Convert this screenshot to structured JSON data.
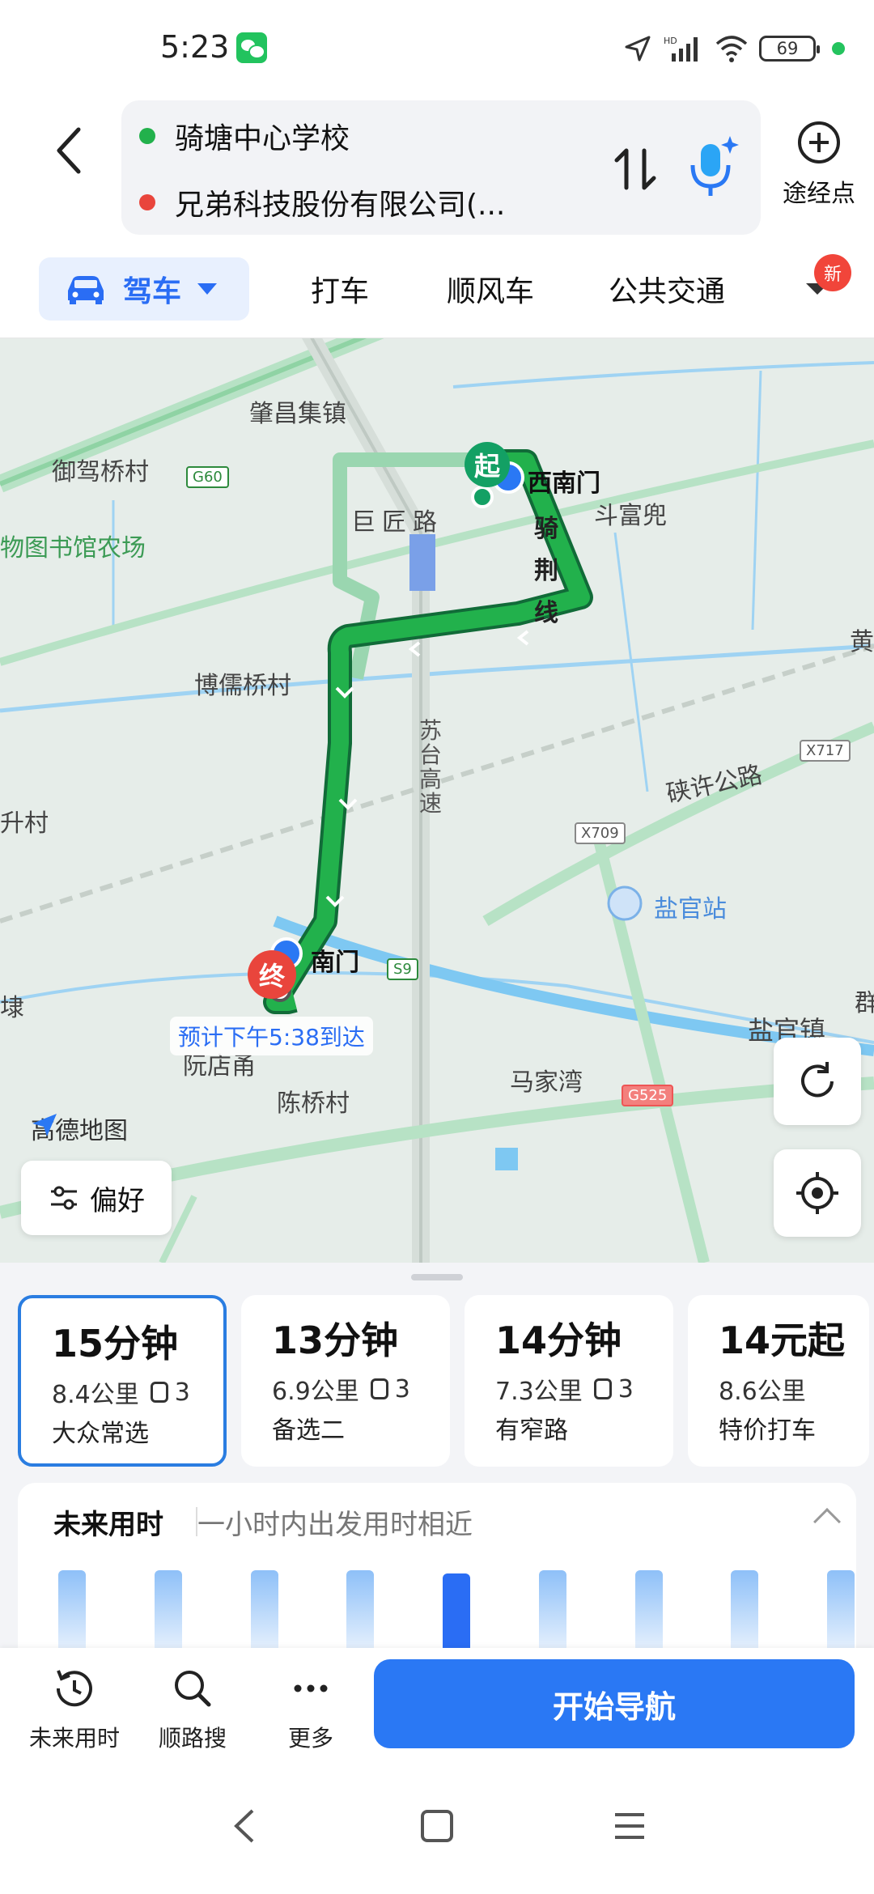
{
  "status_bar": {
    "time": "5:23",
    "battery": "69",
    "network": "HD"
  },
  "route": {
    "origin": "骑塘中心学校",
    "destination": "兄弟科技股份有限公司(...",
    "waypoint_label": "途经点"
  },
  "tabs": [
    {
      "label": "驾车",
      "active": true
    },
    {
      "label": "打车"
    },
    {
      "label": "顺风车"
    },
    {
      "label": "公共交通"
    }
  ],
  "new_badge": "新",
  "map": {
    "labels": {
      "zhaochang": "肇昌集镇",
      "yujiaqiao": "御驾桥村",
      "wutushuguan": "物图书馆农场",
      "jujianglu": "巨匠路",
      "doufudou": "斗富兜",
      "qijingxian": "骑荆线",
      "borunqiao": "博儒桥村",
      "sutai": "苏台高速",
      "shengcun": "升村",
      "xiaxulu": "硖许公路",
      "yanguan_station": "盐官站",
      "yanguan_town": "盐官镇",
      "majiawan": "马家湾",
      "chenqiao": "陈桥村",
      "yuandian": "阮店甬",
      "huang": "黄",
      "qun": "群",
      "lu": "埭",
      "west_south_gate": "西南门",
      "south_gate": "南门"
    },
    "shields": {
      "g60": "G60",
      "x717": "X717",
      "x709": "X709",
      "s9": "S9",
      "g525": "G525"
    },
    "start_pin": "起",
    "end_pin": "终",
    "eta": "预计下午5:38到达",
    "logo": "高德地图"
  },
  "preference_label": "偏好",
  "routes": [
    {
      "time": "15分钟",
      "distance": "8.4公里",
      "lights": "3",
      "tag": "大众常选",
      "selected": true
    },
    {
      "time": "13分钟",
      "distance": "6.9公里",
      "lights": "3",
      "tag": "备选二"
    },
    {
      "time": "14分钟",
      "distance": "7.3公里",
      "lights": "3",
      "tag": "有窄路"
    },
    {
      "time": "14元起",
      "distance": "8.6公里",
      "tag": "特价打车"
    }
  ],
  "future": {
    "title": "未来用时",
    "subtitle": "一小时内出发用时相近",
    "bars": 9,
    "active_bar_index": 4
  },
  "actions": {
    "future_time": "未来用时",
    "route_search": "顺路搜",
    "more": "更多",
    "start_nav": "开始导航"
  },
  "colors": {
    "accent": "#2a78f4",
    "route_green": "#22b14c",
    "end_red": "#e9453c",
    "start_green": "#13a064"
  }
}
